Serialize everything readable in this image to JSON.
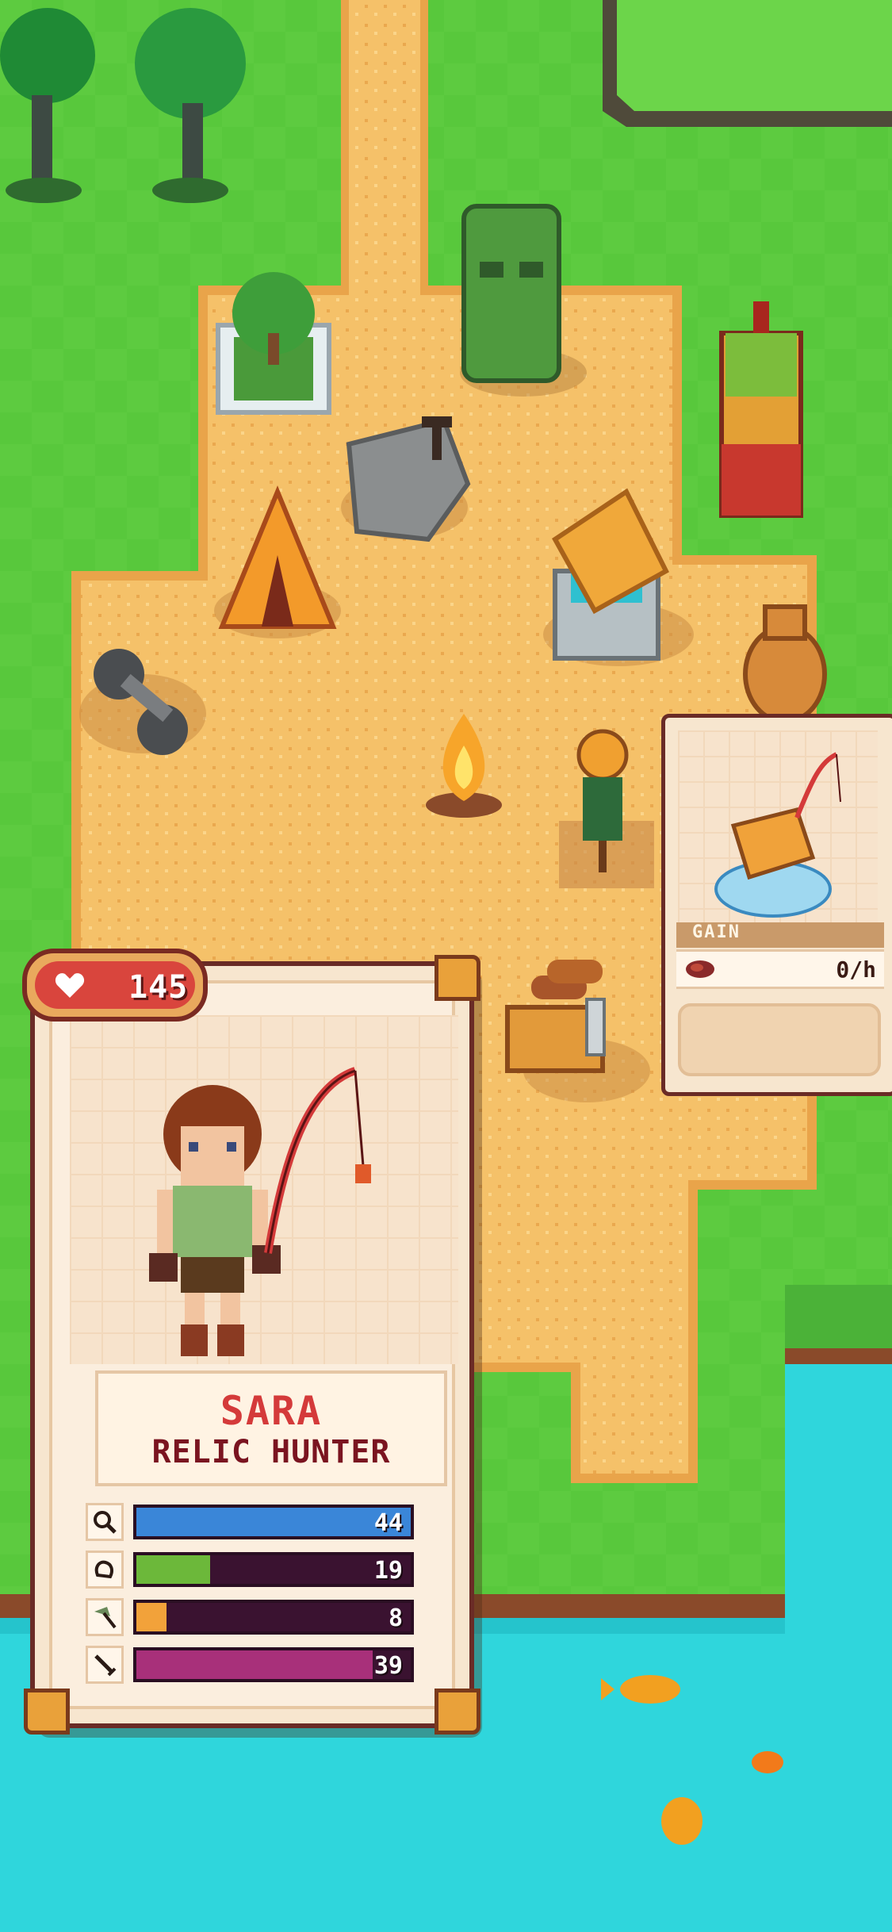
{
  "character": {
    "hp": "145",
    "name": "SARA",
    "title": "RELIC HUNTER",
    "stats": [
      {
        "icon": "magnifier-icon",
        "value": "44",
        "fill": 1.0,
        "color": "#3a86d8"
      },
      {
        "icon": "fist-icon",
        "value": "19",
        "fill": 0.27,
        "color": "#6cb83a"
      },
      {
        "icon": "axe-icon",
        "value": "8",
        "fill": 0.11,
        "color": "#f2a23a"
      },
      {
        "icon": "sword-icon",
        "value": "39",
        "fill": 0.86,
        "color": "#a8307a"
      }
    ]
  },
  "building_panel": {
    "gain_label": "GAIN",
    "gain_value": "0/h",
    "item_icon": "meat-icon"
  },
  "colors": {
    "grass": "#55c53a",
    "sand": "#f6c36b",
    "water": "#2fd6dc",
    "card_border": "#6a2b26"
  }
}
